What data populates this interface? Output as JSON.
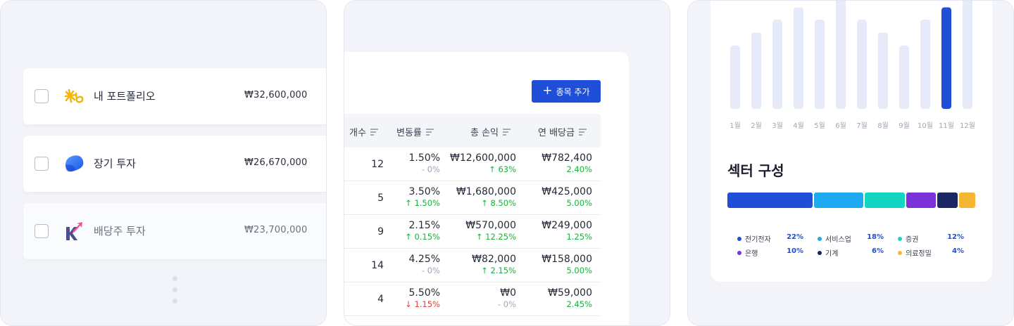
{
  "portfolios": [
    {
      "name": "내 포트폴리오",
      "value": "₩32,600,000",
      "logo": "kb-star-icon"
    },
    {
      "name": "장기 투자",
      "value": "₩26,670,000",
      "logo": "toss-icon"
    },
    {
      "name": "배당주 투자",
      "value": "₩23,700,000",
      "logo": "kiwoom-icon"
    }
  ],
  "table": {
    "add_button": "종목 추가",
    "headers": [
      "개수",
      "변동률",
      "총 손익",
      "연 배당금"
    ],
    "rows": [
      {
        "count": "12",
        "rate": "1.50%",
        "rate_change": "- 0%",
        "rate_dir": "neutral",
        "pnl": "₩12,600,000",
        "pnl_change": "63%",
        "pnl_dir": "up",
        "dividend": "₩782,400",
        "yield": "2.40%"
      },
      {
        "count": "5",
        "rate": "3.50%",
        "rate_change": "1.50%",
        "rate_dir": "up",
        "pnl": "₩1,680,000",
        "pnl_change": "8.50%",
        "pnl_dir": "up",
        "dividend": "₩425,000",
        "yield": "5.00%"
      },
      {
        "count": "9",
        "rate": "2.15%",
        "rate_change": "0.15%",
        "rate_dir": "up",
        "pnl": "₩570,000",
        "pnl_change": "12.25%",
        "pnl_dir": "up",
        "dividend": "₩249,000",
        "yield": "1.25%"
      },
      {
        "count": "14",
        "rate": "4.25%",
        "rate_change": "- 0%",
        "rate_dir": "neutral",
        "pnl": "₩82,000",
        "pnl_change": "2.15%",
        "pnl_dir": "up",
        "dividend": "₩158,000",
        "yield": "5.00%"
      },
      {
        "count": "4",
        "rate": "5.50%",
        "rate_change": "1.15%",
        "rate_dir": "down",
        "pnl": "₩0",
        "pnl_change": "- 0%",
        "pnl_dir": "neutral",
        "dividend": "₩59,000",
        "yield": "2.45%"
      }
    ]
  },
  "chart_data": {
    "type": "bar",
    "categories": [
      "1월",
      "2월",
      "3월",
      "4월",
      "5월",
      "6월",
      "7월",
      "8월",
      "9월",
      "10월",
      "11월",
      "12월"
    ],
    "values": [
      88,
      106,
      124,
      141,
      124,
      158,
      124,
      106,
      88,
      124,
      141,
      158
    ],
    "highlight_index": 10,
    "ylim": [
      0,
      160
    ],
    "colors": {
      "bar": "#e7eaf8",
      "highlight": "#1f4fd8"
    }
  },
  "sector": {
    "title": "섹터 구성",
    "items": [
      {
        "name": "전기전자",
        "pct": "22%",
        "share": 36,
        "color": "#1f4fd8"
      },
      {
        "name": "서비스업",
        "pct": "18%",
        "share": 21,
        "color": "#1eaaf1"
      },
      {
        "name": "증권",
        "pct": "12%",
        "share": 17,
        "color": "#12d6c0"
      },
      {
        "name": "은행",
        "pct": "10%",
        "share": 12.5,
        "color": "#7a33d8"
      },
      {
        "name": "기계",
        "pct": "6%",
        "share": 8.5,
        "color": "#1b2665"
      },
      {
        "name": "의료정밀",
        "pct": "4%",
        "share": 7,
        "color": "#f7b631"
      }
    ]
  }
}
